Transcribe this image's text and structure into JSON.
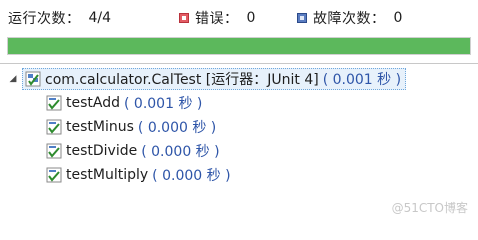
{
  "stats": {
    "runs_label": "运行次数：",
    "runs_value": "4/4",
    "errors_label": "错误：",
    "errors_value": "0",
    "failures_label": "故障次数：",
    "failures_value": "0",
    "error_icon": "error-icon",
    "failure_icon": "failure-icon"
  },
  "progress": {
    "fraction": 1.0,
    "color": "#5cb85c"
  },
  "tree": {
    "root": {
      "name": "com.calculator.CalTest [运行器：JUnit 4]",
      "time": "( 0.001 秒 )",
      "expanded": true,
      "icon": "test-suite-passed-icon"
    },
    "children": [
      {
        "name": "testAdd",
        "time": "( 0.001 秒 )",
        "icon": "test-passed-icon"
      },
      {
        "name": "testMinus",
        "time": "( 0.000 秒 )",
        "icon": "test-passed-icon"
      },
      {
        "name": "testDivide",
        "time": "( 0.000 秒 )",
        "icon": "test-passed-icon"
      },
      {
        "name": "testMultiply",
        "time": "( 0.000 秒 )",
        "icon": "test-passed-icon"
      }
    ]
  },
  "watermark": "@51CTO博客"
}
